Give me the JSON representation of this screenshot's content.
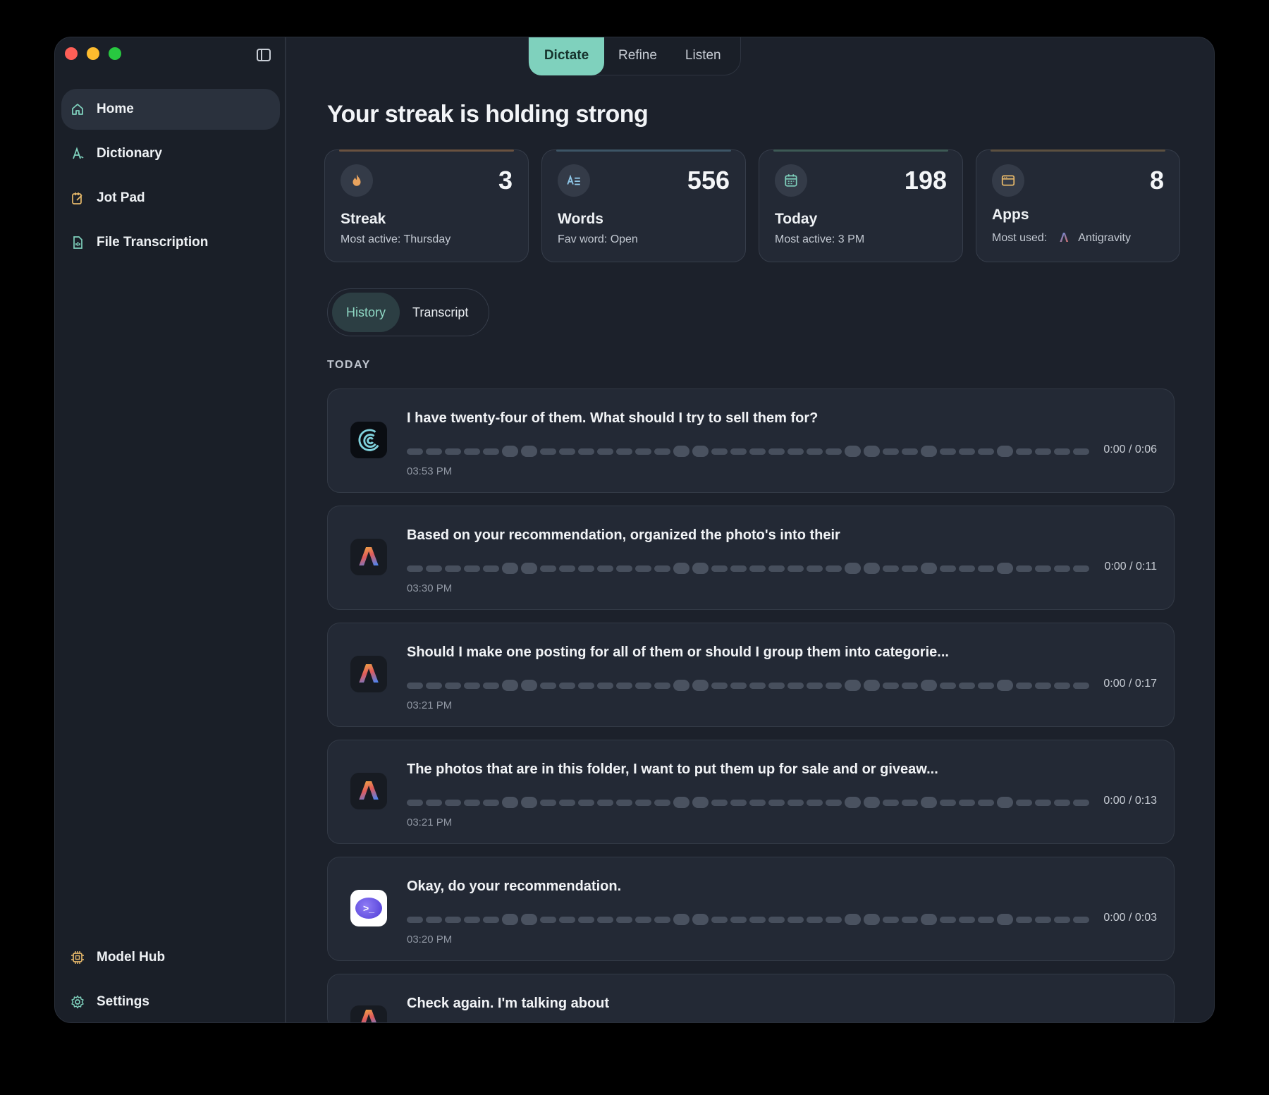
{
  "sidebar": {
    "items": [
      {
        "label": "Home",
        "icon": "home-icon",
        "active": true
      },
      {
        "label": "Dictionary",
        "icon": "dictionary-icon"
      },
      {
        "label": "Jot Pad",
        "icon": "jot-pad-icon"
      },
      {
        "label": "File Transcription",
        "icon": "file-transcription-icon"
      }
    ],
    "bottom": [
      {
        "label": "Model Hub",
        "icon": "chip-icon"
      },
      {
        "label": "Settings",
        "icon": "gear-icon"
      }
    ]
  },
  "mode_tabs": [
    "Dictate",
    "Refine",
    "Listen"
  ],
  "main": {
    "title": "Your streak is holding strong",
    "stats": [
      {
        "value": "3",
        "label": "Streak",
        "sub": "Most active: Thursday",
        "icon": "flame-icon"
      },
      {
        "value": "556",
        "label": "Words",
        "sub": "Fav word: Open",
        "icon": "text-lines-icon"
      },
      {
        "value": "198",
        "label": "Today",
        "sub": "Most active: 3 PM",
        "icon": "calendar-icon"
      },
      {
        "value": "8",
        "label": "Apps",
        "sub_prefix": "Most used:",
        "sub_app": "Antigravity",
        "icon": "window-icon"
      }
    ],
    "sub_tabs": [
      "History",
      "Transcript"
    ],
    "section": "TODAY",
    "history": [
      {
        "text": "I have twenty-four of them. What should I try to sell them for?",
        "duration": "0:00 / 0:06",
        "time": "03:53 PM",
        "app_icon": "wave-app-icon"
      },
      {
        "text": "Based on your recommendation, organized the photo's into their",
        "duration": "0:00 / 0:11",
        "time": "03:30 PM",
        "app_icon": "antigravity-icon"
      },
      {
        "text": "Should I make one posting for all of them or should I group them into categorie...",
        "duration": "0:00 / 0:17",
        "time": "03:21 PM",
        "app_icon": "antigravity-icon"
      },
      {
        "text": "The photos that are in this folder, I want to put them up for sale and or giveaw...",
        "duration": "0:00 / 0:13",
        "time": "03:21 PM",
        "app_icon": "antigravity-icon"
      },
      {
        "text": "Okay, do your recommendation.",
        "duration": "0:00 / 0:03",
        "time": "03:20 PM",
        "app_icon": "bubble-app-icon"
      },
      {
        "text": "Check again. I'm talking about",
        "app_icon": "antigravity-icon"
      }
    ]
  }
}
